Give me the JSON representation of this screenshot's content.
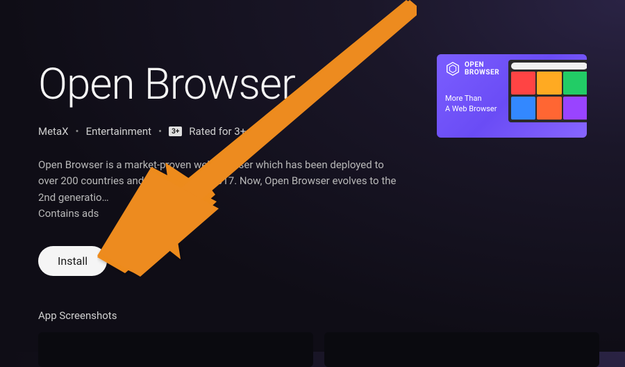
{
  "app": {
    "title": "Open Browser",
    "publisher": "MetaX",
    "category": "Entertainment",
    "rating_badge": "3+",
    "rating_text": "Rated for 3+",
    "description": "Open Browser is a market-proven web browser which has been deployed to over 200 countries and regions since 2017. Now, Open Browser evolves to the 2nd generatio…",
    "ads_notice": "Contains ads",
    "install_label": "Install"
  },
  "promo": {
    "brand_line1": "OPEN",
    "brand_line2": "BROWSER",
    "tagline_line1": "More Than",
    "tagline_line2": "A Web Browser",
    "tile_colors": [
      "#ff4444",
      "#ffaa22",
      "#22cc66",
      "#3388ff",
      "#ff6633",
      "#9944ff"
    ]
  },
  "sections": {
    "screenshots_label": "App Screenshots"
  }
}
